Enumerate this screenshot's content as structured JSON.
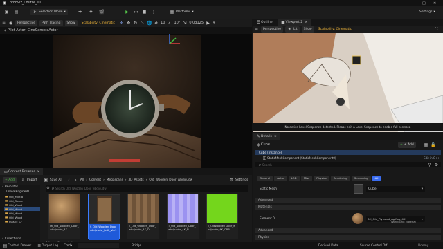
{
  "app": {
    "title": "prodViz_Course_01",
    "close": "×",
    "min": "–",
    "max": "□",
    "close_btn": "✕"
  },
  "menu": {
    "mode": "Selection Mode",
    "platforms": "Platforms",
    "settings": "Settings"
  },
  "viewport1": {
    "pilot": "Pilot Actor: CineCameraActor",
    "perspective": "Perspective",
    "path_tracing": "Path Tracing",
    "show": "Show",
    "scalability": "Scalability: Cinematic",
    "grid": "10",
    "angle": "10°",
    "scale": "0.03125",
    "cam": "4"
  },
  "viewport2": {
    "tab_outliner": "Outliner",
    "tab_viewport": "Viewport 2",
    "perspective": "Perspective",
    "lit": "Lit",
    "show": "Show",
    "scalability": "Scalability: Cinematic",
    "message": "No active Level Sequence detected. Please edit a Level Sequence to enable full controls."
  },
  "details": {
    "tab": "Details",
    "actor": "Cube",
    "add": "+ Add",
    "instance": "Cube (Instance)",
    "component": "StaticMeshComponent (StaticMeshComponent0)",
    "edit_cpp": "Edit in C++",
    "search_placeholder": "Search",
    "filters": [
      "General",
      "Actor",
      "LOD",
      "Misc",
      "Physics",
      "Rendering",
      "Streaming",
      "All"
    ],
    "static_mesh_label": "Static Mesh",
    "static_mesh_value": "Cube",
    "advanced1": "Advanced",
    "materials": "Materials",
    "element": "Element 0",
    "material_value": "MI_Old_Plywood_ngjfiog_4K",
    "world_label": "World Grid Material",
    "advanced2": "Advanced",
    "physics": "Physics"
  },
  "content_browser": {
    "tab": "Content Browser",
    "add": "+ Add",
    "import": "Import",
    "save_all": "Save All",
    "breadcrumb": [
      "All",
      "Content",
      "Megascans",
      "3D_Assets",
      "Old_Wooden_Door_wbdjcudw"
    ],
    "settings": "Settings",
    "favorites": "Favorites",
    "project": "UnrealEngineRT",
    "tree": [
      "Old_Militia",
      "Old_Romo",
      "Old_Wood",
      "Old_Wood",
      "Old_Wood",
      "Old_Wood",
      "Plastic_Cr"
    ],
    "search_placeholder": "Search Old_Wooden_Door_wbdjcudw",
    "assets": [
      {
        "label": "MI_Old_Wooden_Door_wbdjcudw_4K"
      },
      {
        "label": "S_Old_Wooden_Door_wbdjcudw_lod0_Var1"
      },
      {
        "label": "T_Old_Wooden_Door_wbdjcudw_4K_D"
      },
      {
        "label": "T_Old_Wooden_Door_wbdjcudw_4K_N"
      },
      {
        "label": "T_OldWooden Door_wbdjcudw_4K_ORR"
      }
    ],
    "collections": "Collections",
    "status": "5 items (1 selected)"
  },
  "bottom": {
    "content_drawer": "Content Drawer",
    "output_log": "Output Log",
    "cmd": "Cmd",
    "bridge": "Bridge",
    "source_control": "Source Control Off",
    "derived": "Derived Data",
    "udemy": "Udemy"
  }
}
